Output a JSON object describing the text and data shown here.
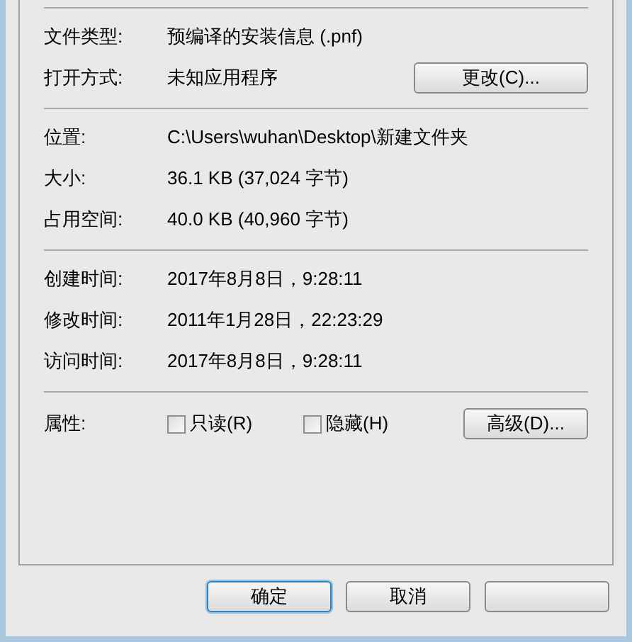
{
  "sections": [
    {
      "rows": [
        {
          "label": "文件类型:",
          "value": "预编译的安装信息 (.pnf)"
        },
        {
          "label": "打开方式:",
          "value": "未知应用程序",
          "button": "更改(C)..."
        }
      ]
    },
    {
      "rows": [
        {
          "label": "位置:",
          "value": "C:\\Users\\wuhan\\Desktop\\新建文件夹"
        },
        {
          "label": "大小:",
          "value": "36.1 KB (37,024 字节)"
        },
        {
          "label": "占用空间:",
          "value": "40.0 KB (40,960 字节)"
        }
      ]
    },
    {
      "rows": [
        {
          "label": "创建时间:",
          "value": "2017年8月8日，9:28:11"
        },
        {
          "label": "修改时间:",
          "value": "2011年1月28日，22:23:29"
        },
        {
          "label": "访问时间:",
          "value": "2017年8月8日，9:28:11"
        }
      ]
    }
  ],
  "attributes": {
    "label": "属性:",
    "checkboxes": [
      {
        "label": "只读(R)",
        "checked": false
      },
      {
        "label": "隐藏(H)",
        "checked": false
      }
    ],
    "button": "高级(D)..."
  },
  "buttons": [
    {
      "label": "确定",
      "selected": true
    },
    {
      "label": "取消",
      "selected": false
    },
    {
      "selected": false
    }
  ]
}
